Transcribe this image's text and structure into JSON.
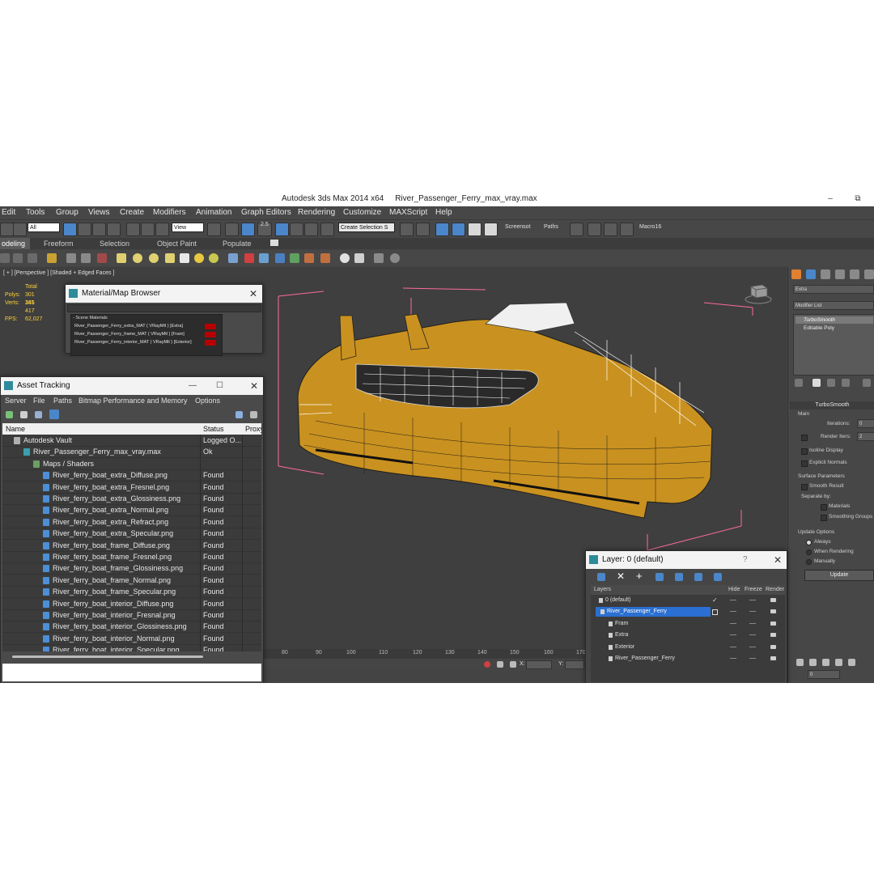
{
  "app": {
    "title": "Autodesk 3ds Max  2014 x64",
    "filename": "River_Passenger_Ferry_max_vray.max",
    "minimize": "–",
    "restore": "⧉"
  },
  "menu": [
    "Edit",
    "Tools",
    "Group",
    "Views",
    "Create",
    "Modifiers",
    "Animation",
    "Graph Editors",
    "Rendering",
    "Customize",
    "MAXScript",
    "Help"
  ],
  "toolbar": {
    "selection_filter": "All",
    "ref_coord": "View",
    "snap_value": "2.5",
    "named_selection_placeholder": "Create Selection S",
    "screenshot_label": "Screensot",
    "paths_label": "Paths",
    "macro_label": "Macro16"
  },
  "ribbon_tabs": [
    "odeling",
    "Freeform",
    "Selection",
    "Object Paint",
    "Populate"
  ],
  "viewport": {
    "label": "[ + ] [Perspective ] [Shaded + Edged Faces ]",
    "stats_total": "Total",
    "polys_label": "Polys:",
    "polys_value": "301 345",
    "verts_label": "Verts:",
    "verts_value": "161 417",
    "fps_label": "FPS:",
    "fps_value": "62,027"
  },
  "material_browser": {
    "title": "Material/Map Browser",
    "close": "✕",
    "group": "- Scene Materials",
    "items": [
      "River_Passenger_Ferry_extra_MAT  ( VRayMtl ) [Extra]",
      "River_Passenger_Ferry_frame_MAT  ( VRayMtl ) [Fram]",
      "River_Passenger_Ferry_interior_MAT  ( VRayMtl ) [Exterior]"
    ]
  },
  "asset_tracking": {
    "title": "Asset Tracking",
    "close": "✕",
    "minimize": "—",
    "maximize": "☐",
    "menu": [
      "Server",
      "File",
      "Paths",
      "Bitmap Performance and Memory",
      "Options"
    ],
    "columns": [
      "Name",
      "Status",
      "Proxy"
    ],
    "rows": [
      {
        "name": "Autodesk Vault",
        "status": "Logged O..."
      },
      {
        "name": "River_Passenger_Ferry_max_vray.max",
        "status": "Ok"
      },
      {
        "name": "Maps / Shaders",
        "status": ""
      },
      {
        "name": "River_ferry_boat_extra_Diffuse.png",
        "status": "Found"
      },
      {
        "name": "River_ferry_boat_extra_Fresnel.png",
        "status": "Found"
      },
      {
        "name": "River_ferry_boat_extra_Glossiness.png",
        "status": "Found"
      },
      {
        "name": "River_ferry_boat_extra_Normal.png",
        "status": "Found"
      },
      {
        "name": "River_ferry_boat_extra_Refract.png",
        "status": "Found"
      },
      {
        "name": "River_ferry_boat_extra_Specular.png",
        "status": "Found"
      },
      {
        "name": "River_ferry_boat_frame_Diffuse.png",
        "status": "Found"
      },
      {
        "name": "River_ferry_boat_frame_Fresnel.png",
        "status": "Found"
      },
      {
        "name": "River_ferry_boat_frame_Glossiness.png",
        "status": "Found"
      },
      {
        "name": "River_ferry_boat_frame_Normal.png",
        "status": "Found"
      },
      {
        "name": "River_ferry_boat_frame_Specular.png",
        "status": "Found"
      },
      {
        "name": "River_ferry_boat_interior_Diffuse.png",
        "status": "Found"
      },
      {
        "name": "River_ferry_boat_interior_Fresnal.png",
        "status": "Found"
      },
      {
        "name": "River_ferry_boat_interior_Glossiness.png",
        "status": "Found"
      },
      {
        "name": "River_ferry_boat_interior_Normal.png",
        "status": "Found"
      },
      {
        "name": "River_ferry_boat_interior_Specular.png",
        "status": "Found"
      }
    ]
  },
  "layer_panel": {
    "title": "Layer: 0 (default)",
    "help": "?",
    "close": "✕",
    "columns": [
      "Layers",
      "Hide",
      "Freeze",
      "Render"
    ],
    "rows": [
      "0 (default)",
      "River_Passenger_Ferry",
      "Fram",
      "Extra",
      "Exterior",
      "River_Passenger_Ferry"
    ]
  },
  "command_panel": {
    "object_name": "Extra",
    "modifier_list": "Modifier List",
    "stack": [
      "TurboSmooth",
      "Editable Poly"
    ],
    "rollout_title": "TurboSmooth",
    "main": "Main",
    "iterations_label": "Iterations:",
    "iterations_value": "0",
    "render_iters_label": "Render Iters:",
    "render_iters_value": "2",
    "isoline": "Isoline Display",
    "explicit_normals": "Explicit Normals",
    "surface_params": "Surface Parameters",
    "smooth_result": "Smooth Result",
    "separate_by": "Separate by:",
    "materials": "Materials",
    "smoothing_groups": "Smoothing Groups",
    "update_options": "Update Options",
    "always": "Always",
    "when_rendering": "When Rendering",
    "manually": "Manually",
    "update_button": "Update"
  },
  "timeline": {
    "ticks": [
      "80",
      "90",
      "100",
      "110",
      "120",
      "130",
      "140",
      "150",
      "160",
      "170"
    ],
    "x_label": "X:",
    "y_label": "Y:",
    "frame_value": "0"
  },
  "colors": {
    "bbox": "#ff6aa0",
    "hull": "#c9911f",
    "selection": "#2a6fd1"
  }
}
